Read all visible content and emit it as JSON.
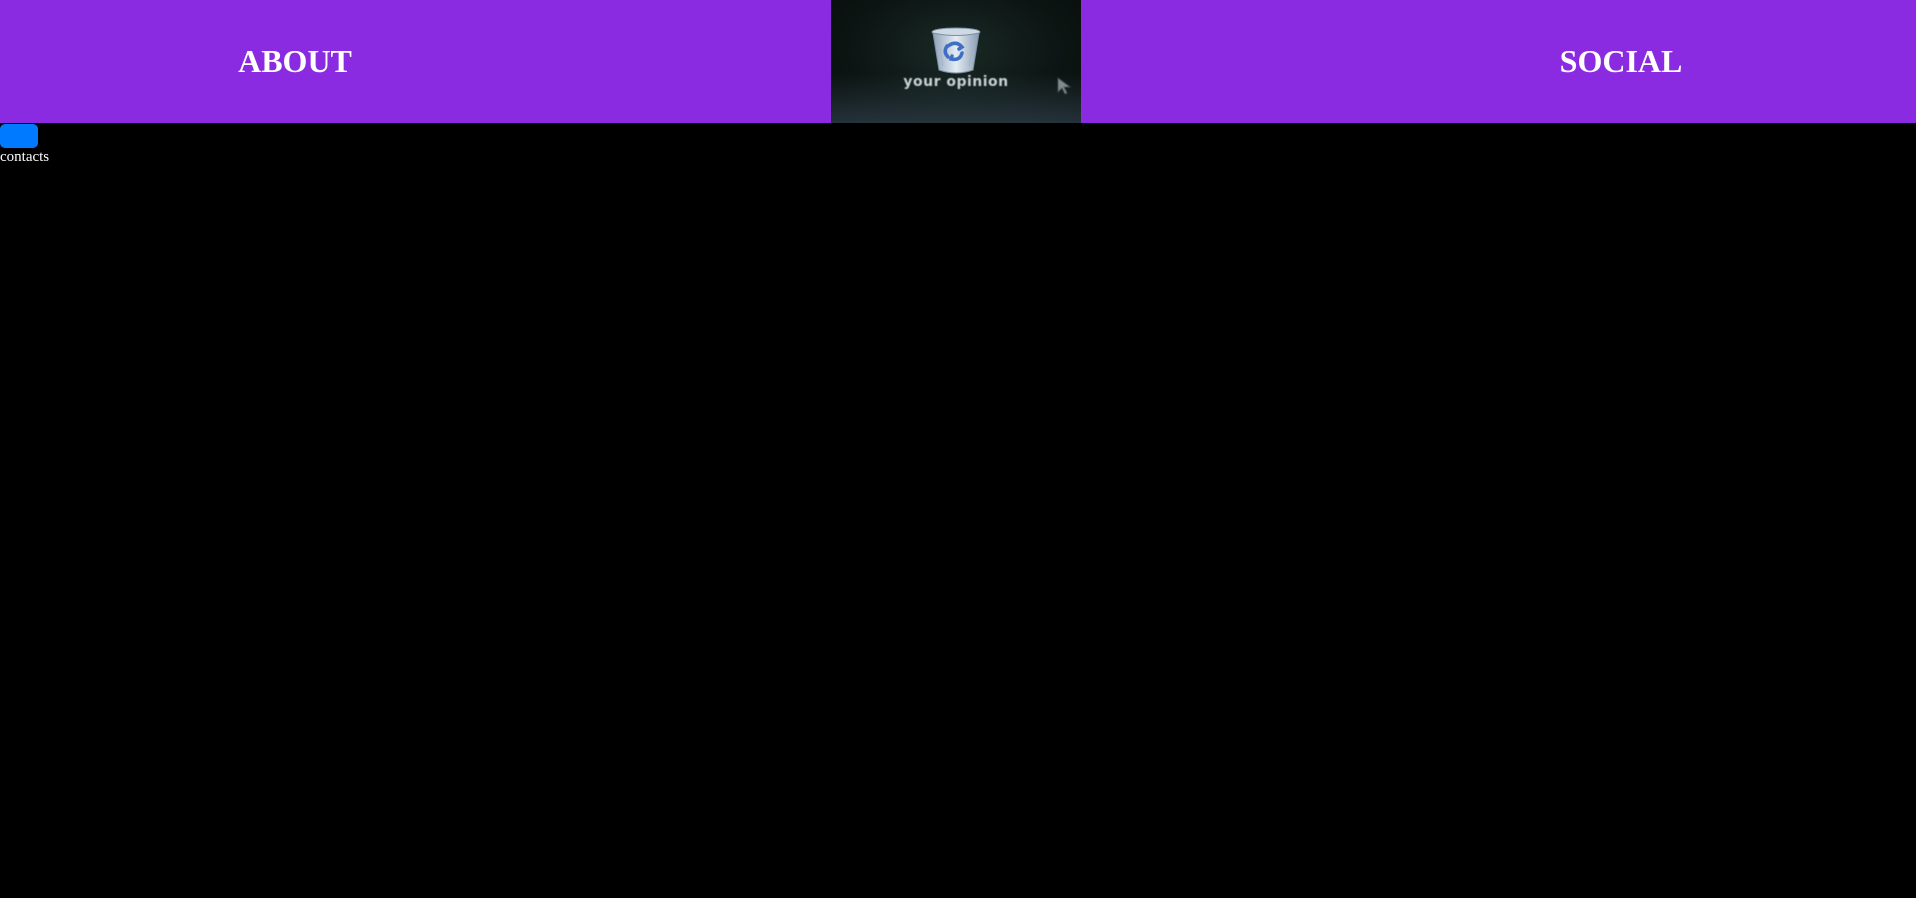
{
  "header": {
    "background_color": "#8a2be2",
    "left_link": "ABOUT",
    "right_link": "SOCIAL",
    "center_image": {
      "caption": "your opinion",
      "icons": [
        "recycle-bin-icon",
        "cursor-arrow-icon"
      ]
    }
  },
  "contacts": {
    "button_color": "#007bff",
    "label": "contacts"
  },
  "page": {
    "background_color": "#000000"
  }
}
